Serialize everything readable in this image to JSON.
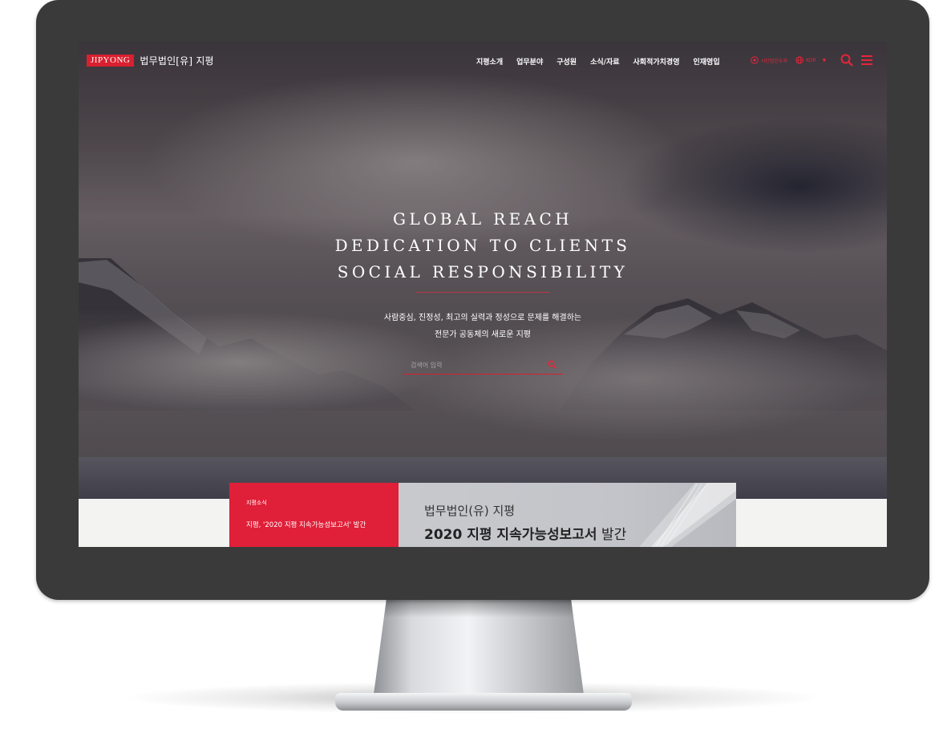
{
  "header": {
    "logo_mark": "JIPYONG",
    "logo_text": "법무법인[유] 지평",
    "nav": [
      "지평소개",
      "업무분야",
      "구성원",
      "소식/자료",
      "사회적가치경영",
      "인재영입"
    ],
    "cert_label": "사단법인두루",
    "lang": "KOR"
  },
  "hero": {
    "headline": [
      "GLOBAL REACH",
      "DEDICATION TO CLIENTS",
      "SOCIAL RESPONSIBILITY"
    ],
    "sub": [
      "사람중심, 진정성, 최고의 실력과 정성으로 문제를 해결하는",
      "전문가 공동체의 새로운 지평"
    ],
    "search_placeholder": "검색어 입력"
  },
  "news": {
    "category": "지평소식",
    "title": "지평, '2020 지평 지속가능성보고서' 발간",
    "banner_line1": "법무법인(유) 지평",
    "banner_line2_bold": "2020 지평 지속가능성보고서",
    "banner_line2_rest": " 발간"
  },
  "colors": {
    "accent": "#e01f38",
    "bezel": "#3a3a3b",
    "banner": "#c6c7cb"
  },
  "icons": [
    "globe-icon",
    "search-icon",
    "menu-icon",
    "chevron-down-icon"
  ]
}
